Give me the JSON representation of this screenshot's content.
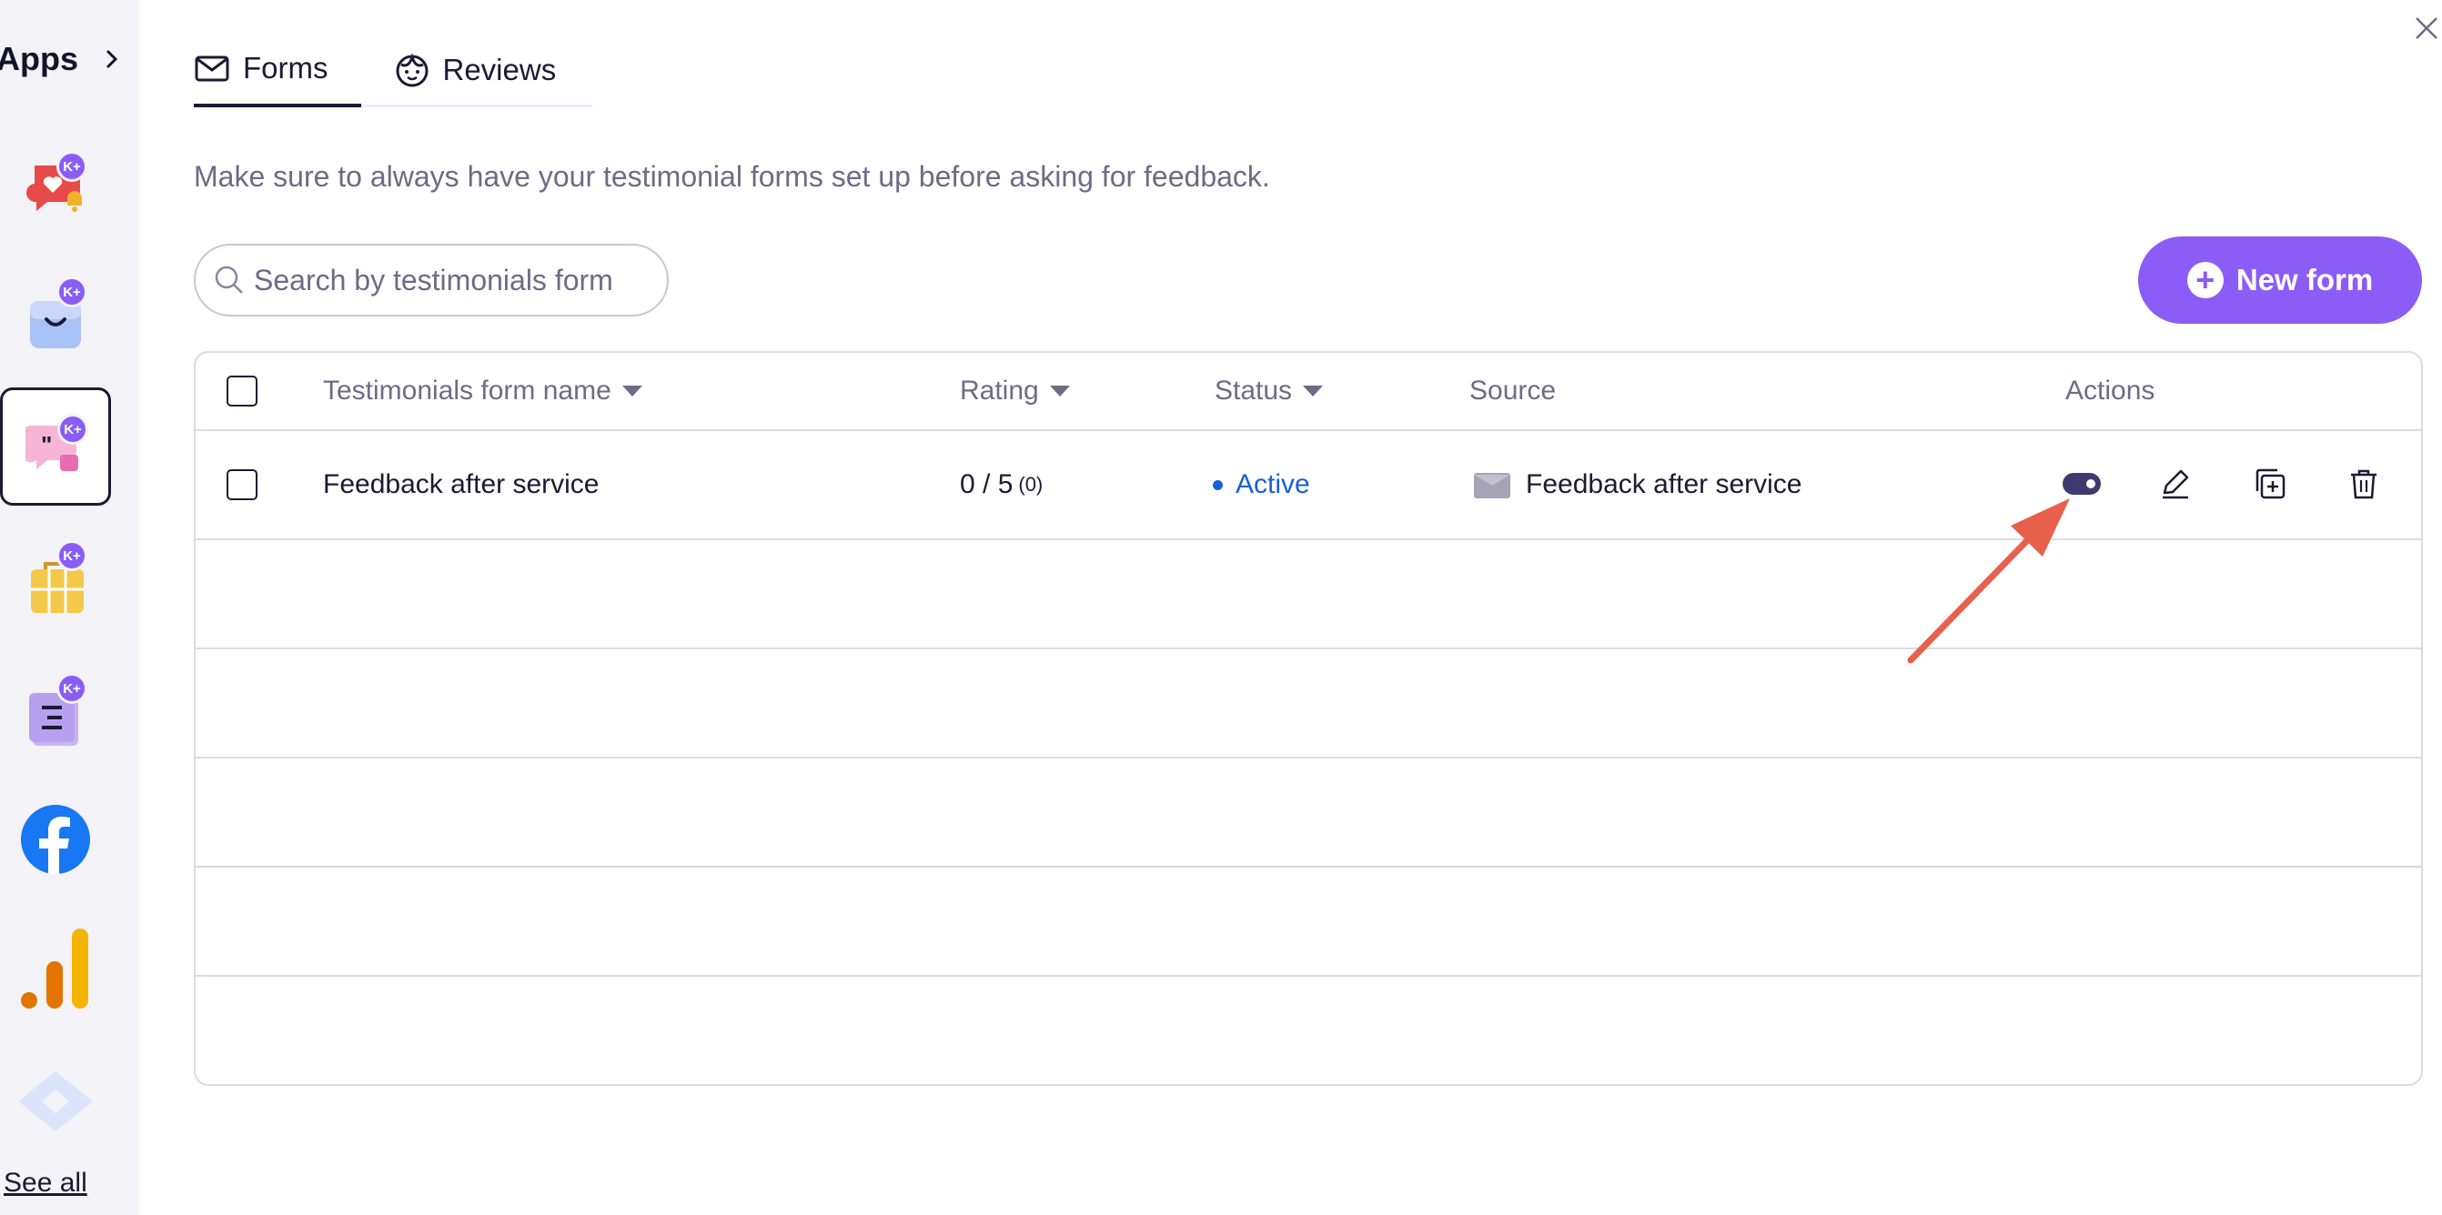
{
  "sidebar": {
    "title": "Apps",
    "badge": "K+",
    "see_all": "See all",
    "apps": [
      {
        "icon": "heart-chat-bell-icon"
      },
      {
        "icon": "shopping-bag-icon"
      },
      {
        "icon": "testimonial-quote-icon",
        "selected": true
      },
      {
        "icon": "calendar-bag-icon"
      },
      {
        "icon": "document-list-icon"
      },
      {
        "icon": "facebook-icon"
      },
      {
        "icon": "analytics-bars-icon"
      },
      {
        "icon": "diamond-tag-icon"
      }
    ]
  },
  "tabs": [
    {
      "label": "Forms",
      "icon": "envelope-icon",
      "active": true
    },
    {
      "label": "Reviews",
      "icon": "face-icon",
      "active": false
    }
  ],
  "intro_text": "Make sure to always have your testimonial forms set up before asking for feedback.",
  "search": {
    "placeholder": "Search by testimonials form"
  },
  "new_form_label": "New form",
  "table": {
    "headers": {
      "name": "Testimonials form name",
      "rating": "Rating",
      "status": "Status",
      "source": "Source",
      "actions": "Actions"
    },
    "rows": [
      {
        "name": "Feedback after service",
        "rating": "0 / 5",
        "rating_count": "(0)",
        "status": "Active",
        "source": "Feedback after service"
      }
    ]
  },
  "colors": {
    "accent": "#8b5cf6",
    "active_status": "#1a5fd6",
    "annotation_arrow": "#e8604c"
  }
}
